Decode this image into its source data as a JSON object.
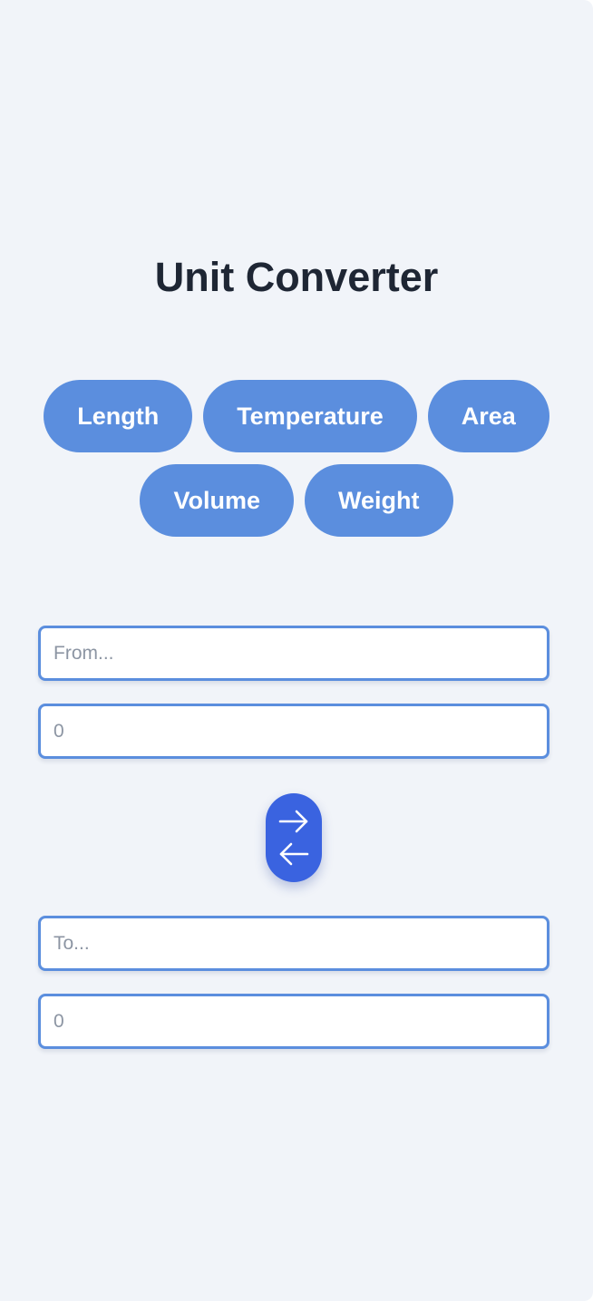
{
  "app": {
    "title": "Unit Converter"
  },
  "categories": [
    {
      "label": "Length"
    },
    {
      "label": "Temperature"
    },
    {
      "label": "Area"
    },
    {
      "label": "Volume"
    },
    {
      "label": "Weight"
    }
  ],
  "from": {
    "unit_placeholder": "From...",
    "unit_value": "",
    "amount_placeholder": "0",
    "amount_value": ""
  },
  "to": {
    "unit_placeholder": "To...",
    "unit_value": "",
    "amount_placeholder": "0",
    "amount_value": ""
  },
  "swap_button": {
    "icon": "swap-arrows-icon"
  },
  "colors": {
    "background": "#f1f4f9",
    "category_button": "#5b8ede",
    "field_border": "#5b8ede",
    "swap_button": "#3a63e0",
    "title_text": "#1e2634"
  }
}
